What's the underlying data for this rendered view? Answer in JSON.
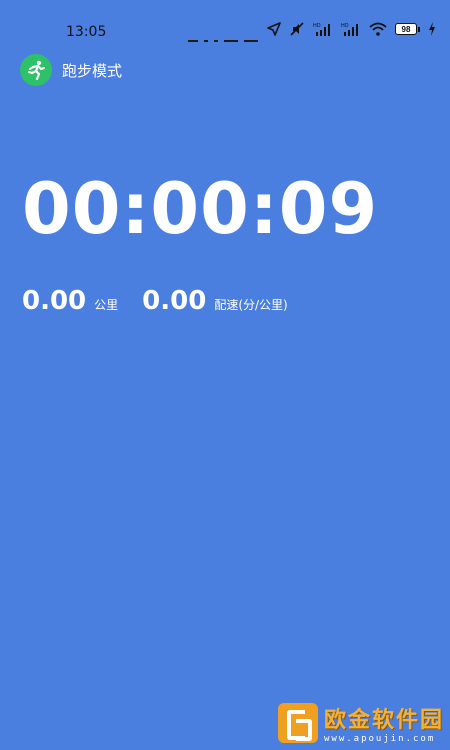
{
  "status_bar": {
    "time": "13:05",
    "battery_level": "98",
    "icons": [
      "location-arrow-icon",
      "mute-icon",
      "hd-signal-icon",
      "hd-signal-icon",
      "wifi-icon",
      "battery-icon",
      "charging-icon"
    ]
  },
  "app_bar": {
    "icon": "running-person-icon",
    "icon_color": "#2ec16a",
    "title": "跑步模式"
  },
  "timer": {
    "elapsed": "00:00:09"
  },
  "stats": {
    "distance": {
      "value": "0.00",
      "unit": "公里"
    },
    "pace": {
      "value": "0.00",
      "unit": "配速(分/公里)"
    }
  },
  "watermark": {
    "title": "欧金软件园",
    "url": "www.apoujin.com"
  },
  "colors": {
    "background": "#4a7fe0",
    "text": "#ffffff",
    "watermark": "#f5b03a"
  }
}
